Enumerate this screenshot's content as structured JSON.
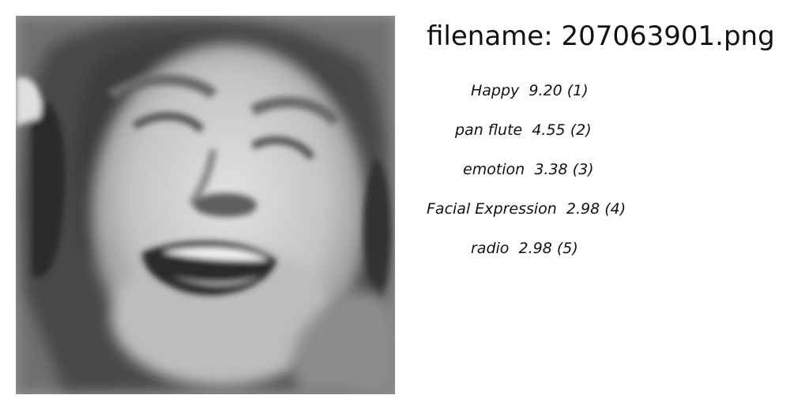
{
  "image": {
    "alt": "grayscale photo of a laughing woman wearing headphones"
  },
  "filename_label": "filename: 207063901.png",
  "predictions": [
    {
      "label": "Happy",
      "score": "9.20",
      "rank": "(1)"
    },
    {
      "label": "pan flute",
      "score": "4.55",
      "rank": "(2)"
    },
    {
      "label": "emotion",
      "score": "3.38",
      "rank": "(3)"
    },
    {
      "label": "Facial Expression",
      "score": "2.98",
      "rank": "(4)"
    },
    {
      "label": "radio",
      "score": "2.98",
      "rank": "(5)"
    }
  ]
}
